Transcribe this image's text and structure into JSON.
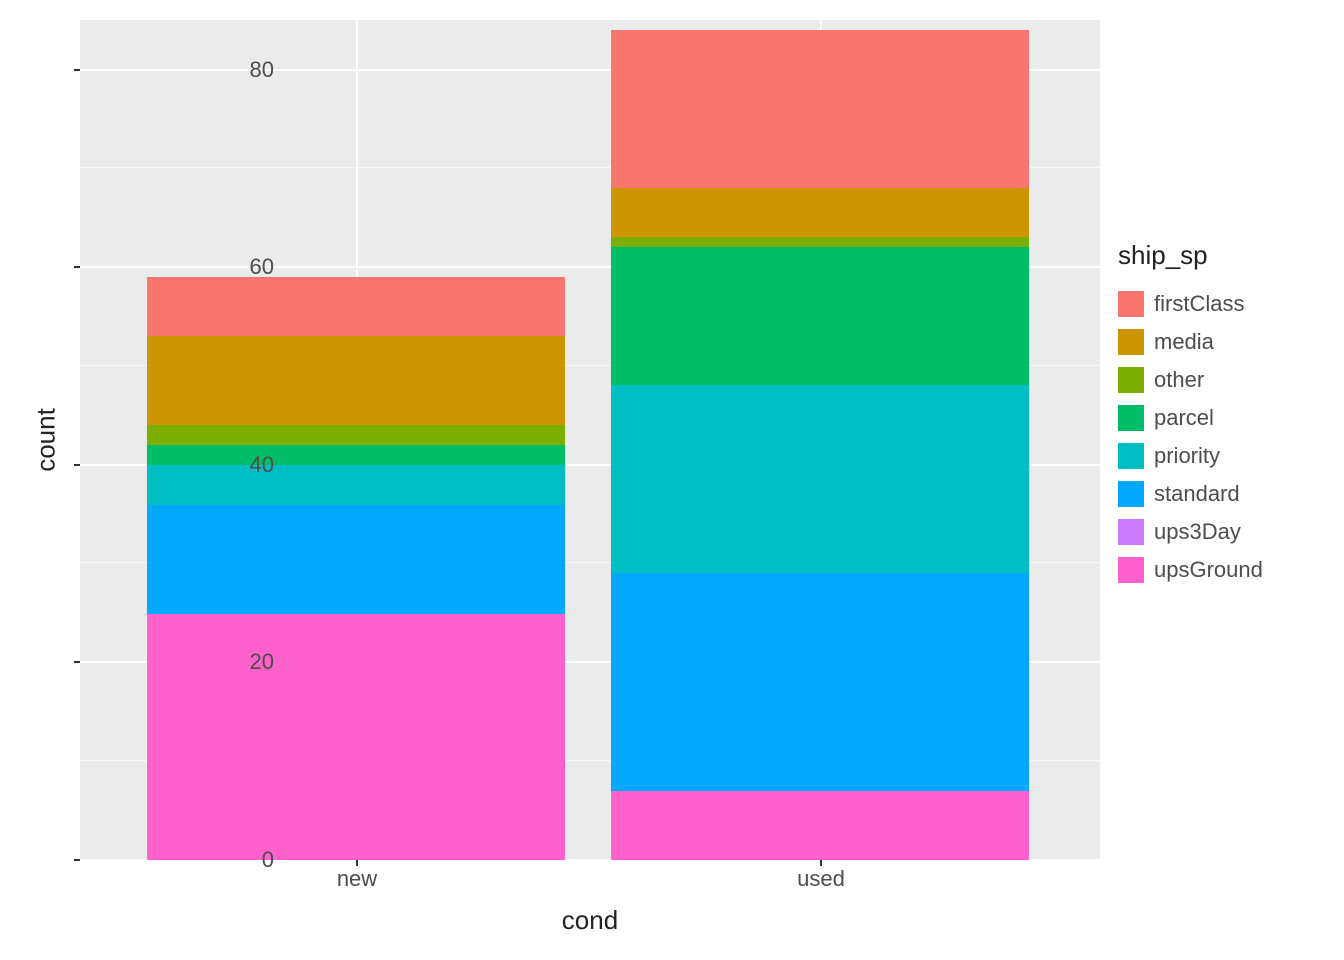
{
  "chart_data": {
    "type": "bar",
    "stacked": true,
    "xlabel": "cond",
    "ylabel": "count",
    "categories": [
      "new",
      "used"
    ],
    "ylim": [
      0,
      85
    ],
    "y_ticks": [
      0,
      20,
      40,
      60,
      80
    ],
    "legend_title": "ship_sp",
    "legend_order": [
      "firstClass",
      "media",
      "other",
      "parcel",
      "priority",
      "standard",
      "ups3Day",
      "upsGround"
    ],
    "stack_order_bottom_to_top": [
      "upsGround",
      "ups3Day",
      "standard",
      "priority",
      "parcel",
      "other",
      "media",
      "firstClass"
    ],
    "series": [
      {
        "name": "firstClass",
        "color": "#F8766D",
        "values": {
          "new": 6,
          "used": 16
        }
      },
      {
        "name": "media",
        "color": "#CD9600",
        "values": {
          "new": 9,
          "used": 5
        }
      },
      {
        "name": "other",
        "color": "#7CAE00",
        "values": {
          "new": 2,
          "used": 1
        }
      },
      {
        "name": "parcel",
        "color": "#00BE67",
        "values": {
          "new": 2,
          "used": 14
        }
      },
      {
        "name": "priority",
        "color": "#00BFC4",
        "values": {
          "new": 4,
          "used": 19
        }
      },
      {
        "name": "standard",
        "color": "#00A9FF",
        "values": {
          "new": 11,
          "used": 22
        }
      },
      {
        "name": "ups3Day",
        "color": "#C77CFF",
        "values": {
          "new": 0,
          "used": 0
        }
      },
      {
        "name": "upsGround",
        "color": "#FF61CC",
        "values": {
          "new": 25,
          "used": 7
        }
      }
    ]
  },
  "y_tick_labels": {
    "t0": "0",
    "t20": "20",
    "t40": "40",
    "t60": "60",
    "t80": "80"
  },
  "x_tick_labels": {
    "new": "new",
    "used": "used"
  }
}
